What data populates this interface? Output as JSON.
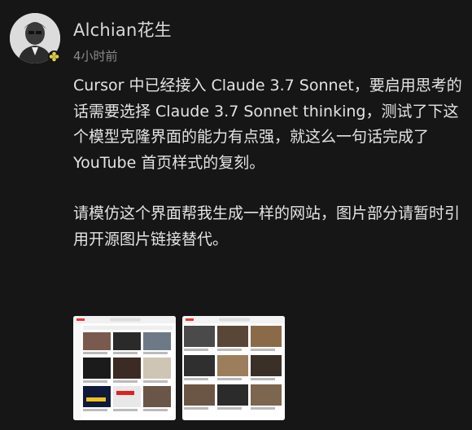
{
  "post": {
    "author": "Alchian花生",
    "time": "4小时前",
    "paragraph1": "Cursor 中已经接入 Claude 3.7 Sonnet，要启用思考的话需要选择 Claude 3.7 Sonnet thinking，测试了下这个模型克隆界面的能力有点强，就这么一句话完成了 YouTube 首页样式的复刻。",
    "paragraph2": "请模仿这个界面帮我生成一样的网站，图片部分请暂时引用开源图片链接替代。"
  },
  "thumbnails": [
    {
      "name": "youtube-original-screenshot"
    },
    {
      "name": "youtube-clone-screenshot"
    }
  ],
  "icons": {
    "badge": "flower-badge-icon"
  }
}
